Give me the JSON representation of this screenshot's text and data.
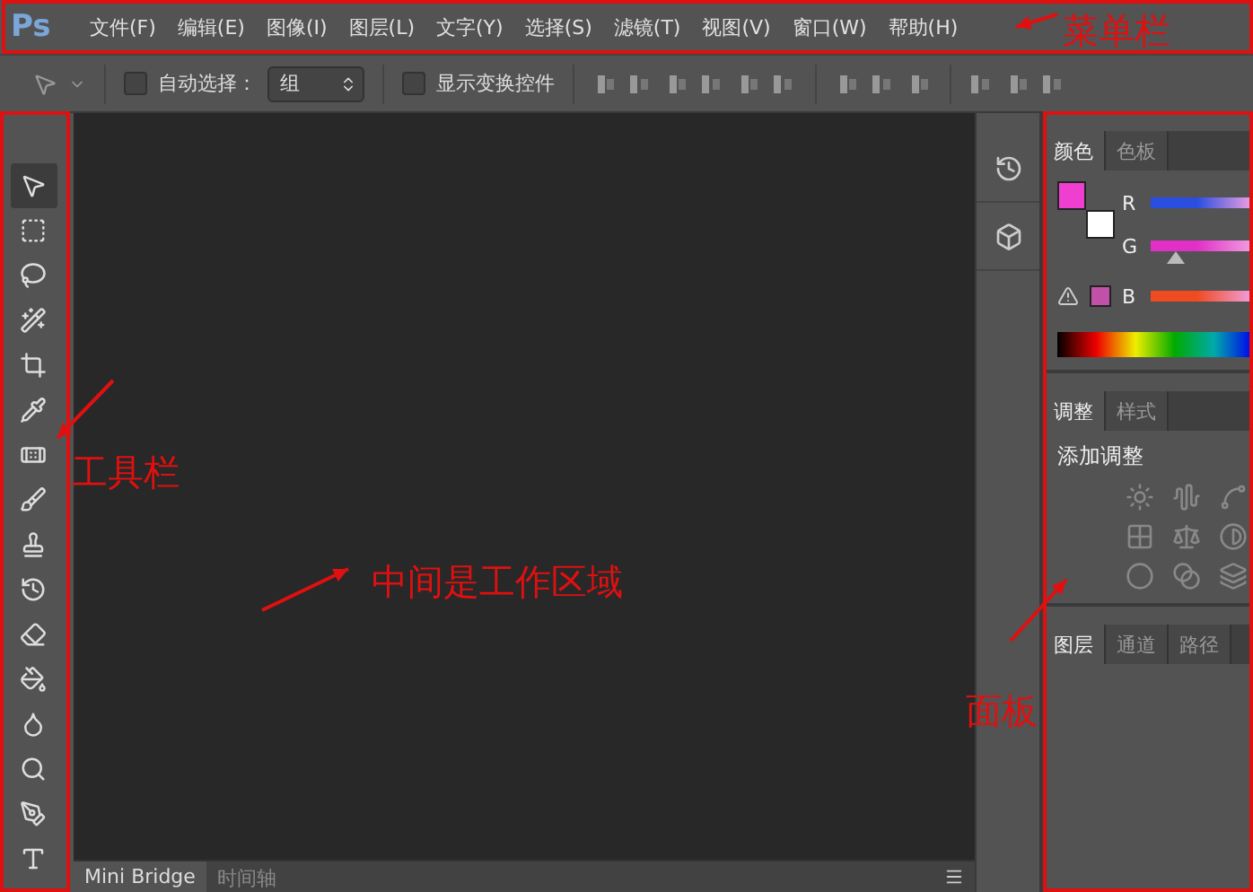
{
  "app_logo": "Ps",
  "menu": [
    "文件(F)",
    "编辑(E)",
    "图像(I)",
    "图层(L)",
    "文字(Y)",
    "选择(S)",
    "滤镜(T)",
    "视图(V)",
    "窗口(W)",
    "帮助(H)"
  ],
  "options_bar": {
    "auto_select": {
      "label": "自动选择：",
      "checked": false
    },
    "select_value": "组",
    "show_transform": {
      "label": "显示变换控件",
      "checked": false
    }
  },
  "tools": [
    {
      "kind": "move",
      "selected": true
    },
    {
      "kind": "marquee",
      "selected": false
    },
    {
      "kind": "lasso",
      "selected": false
    },
    {
      "kind": "quickselect",
      "selected": false
    },
    {
      "kind": "crop",
      "selected": false
    },
    {
      "kind": "eyedropper",
      "selected": false
    },
    {
      "kind": "healing",
      "selected": false
    },
    {
      "kind": "brush",
      "selected": false
    },
    {
      "kind": "stamp",
      "selected": false
    },
    {
      "kind": "history",
      "selected": false
    },
    {
      "kind": "eraser",
      "selected": false
    },
    {
      "kind": "bucket",
      "selected": false
    },
    {
      "kind": "blur",
      "selected": false
    },
    {
      "kind": "dodge",
      "selected": false
    },
    {
      "kind": "pen",
      "selected": false
    },
    {
      "kind": "type",
      "selected": false
    }
  ],
  "bottom_tabs": [
    {
      "label": "Mini Bridge",
      "selected": true
    },
    {
      "label": "时间轴",
      "selected": false
    }
  ],
  "color_panel": {
    "tabs": [
      {
        "label": "颜色",
        "selected": true
      },
      {
        "label": "色板",
        "selected": false
      }
    ],
    "swatches": [
      {
        "color": "#ee3fd0"
      },
      {
        "color": "#ffffff"
      }
    ],
    "channels": [
      {
        "label": "R",
        "color": "#2a4ee0"
      },
      {
        "label": "G",
        "color": "#e030c8",
        "level": 0.25
      },
      {
        "label": "B",
        "color": "#f04a20"
      }
    ]
  },
  "adjust_panel": {
    "tabs": [
      {
        "label": "调整",
        "selected": true
      },
      {
        "label": "样式",
        "selected": false
      }
    ],
    "heading": "添加调整"
  },
  "layers_panel": {
    "tabs": [
      {
        "label": "图层",
        "selected": true
      },
      {
        "label": "通道",
        "selected": false
      },
      {
        "label": "路径",
        "selected": false
      }
    ]
  },
  "annotations": [
    "菜单栏",
    "工具栏",
    "中间是工作区域",
    "面板"
  ]
}
